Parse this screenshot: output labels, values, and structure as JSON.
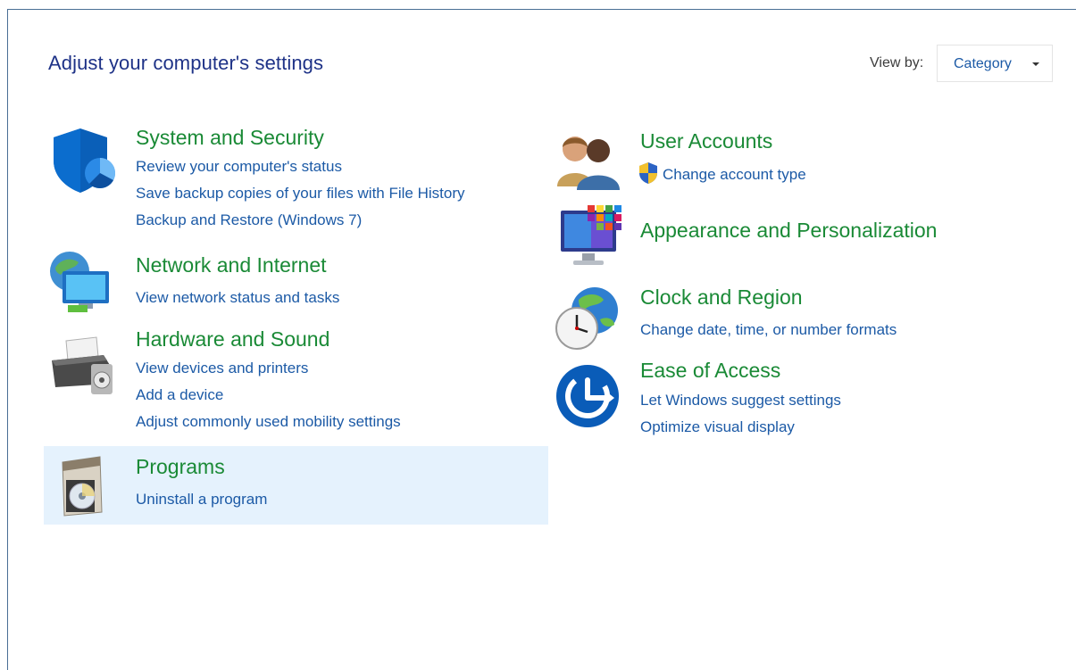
{
  "page": {
    "title": "Adjust your computer's settings",
    "view_by_label": "View by:",
    "view_by_value": "Category"
  },
  "categories": [
    {
      "title": "System and Security",
      "icon": "shield-icon",
      "links": [
        "Review your computer's status",
        "Save backup copies of your files with File History",
        "Backup and Restore (Windows 7)"
      ]
    },
    {
      "title": "Network and Internet",
      "icon": "network-icon",
      "links": [
        "View network status and tasks"
      ]
    },
    {
      "title": "Hardware and Sound",
      "icon": "printer-icon",
      "links": [
        "View devices and printers",
        "Add a device",
        "Adjust commonly used mobility settings"
      ]
    },
    {
      "title": "Programs",
      "icon": "programs-icon",
      "links": [
        "Uninstall a program"
      ],
      "highlighted": true
    },
    {
      "title": "User Accounts",
      "icon": "user-accounts-icon",
      "links": [
        "Change account type"
      ],
      "link_icon": "uac-shield-icon"
    },
    {
      "title": "Appearance and Personalization",
      "icon": "monitor-palette-icon",
      "links": []
    },
    {
      "title": "Clock and Region",
      "icon": "clock-globe-icon",
      "links": [
        "Change date, time, or number formats"
      ]
    },
    {
      "title": "Ease of Access",
      "icon": "ease-of-access-icon",
      "links": [
        "Let Windows suggest settings",
        "Optimize visual display"
      ]
    }
  ],
  "colors": {
    "title": "#1e3287",
    "category_title": "#1a8a36",
    "link": "#1c5aa6",
    "highlight": "#e5f2fd"
  }
}
